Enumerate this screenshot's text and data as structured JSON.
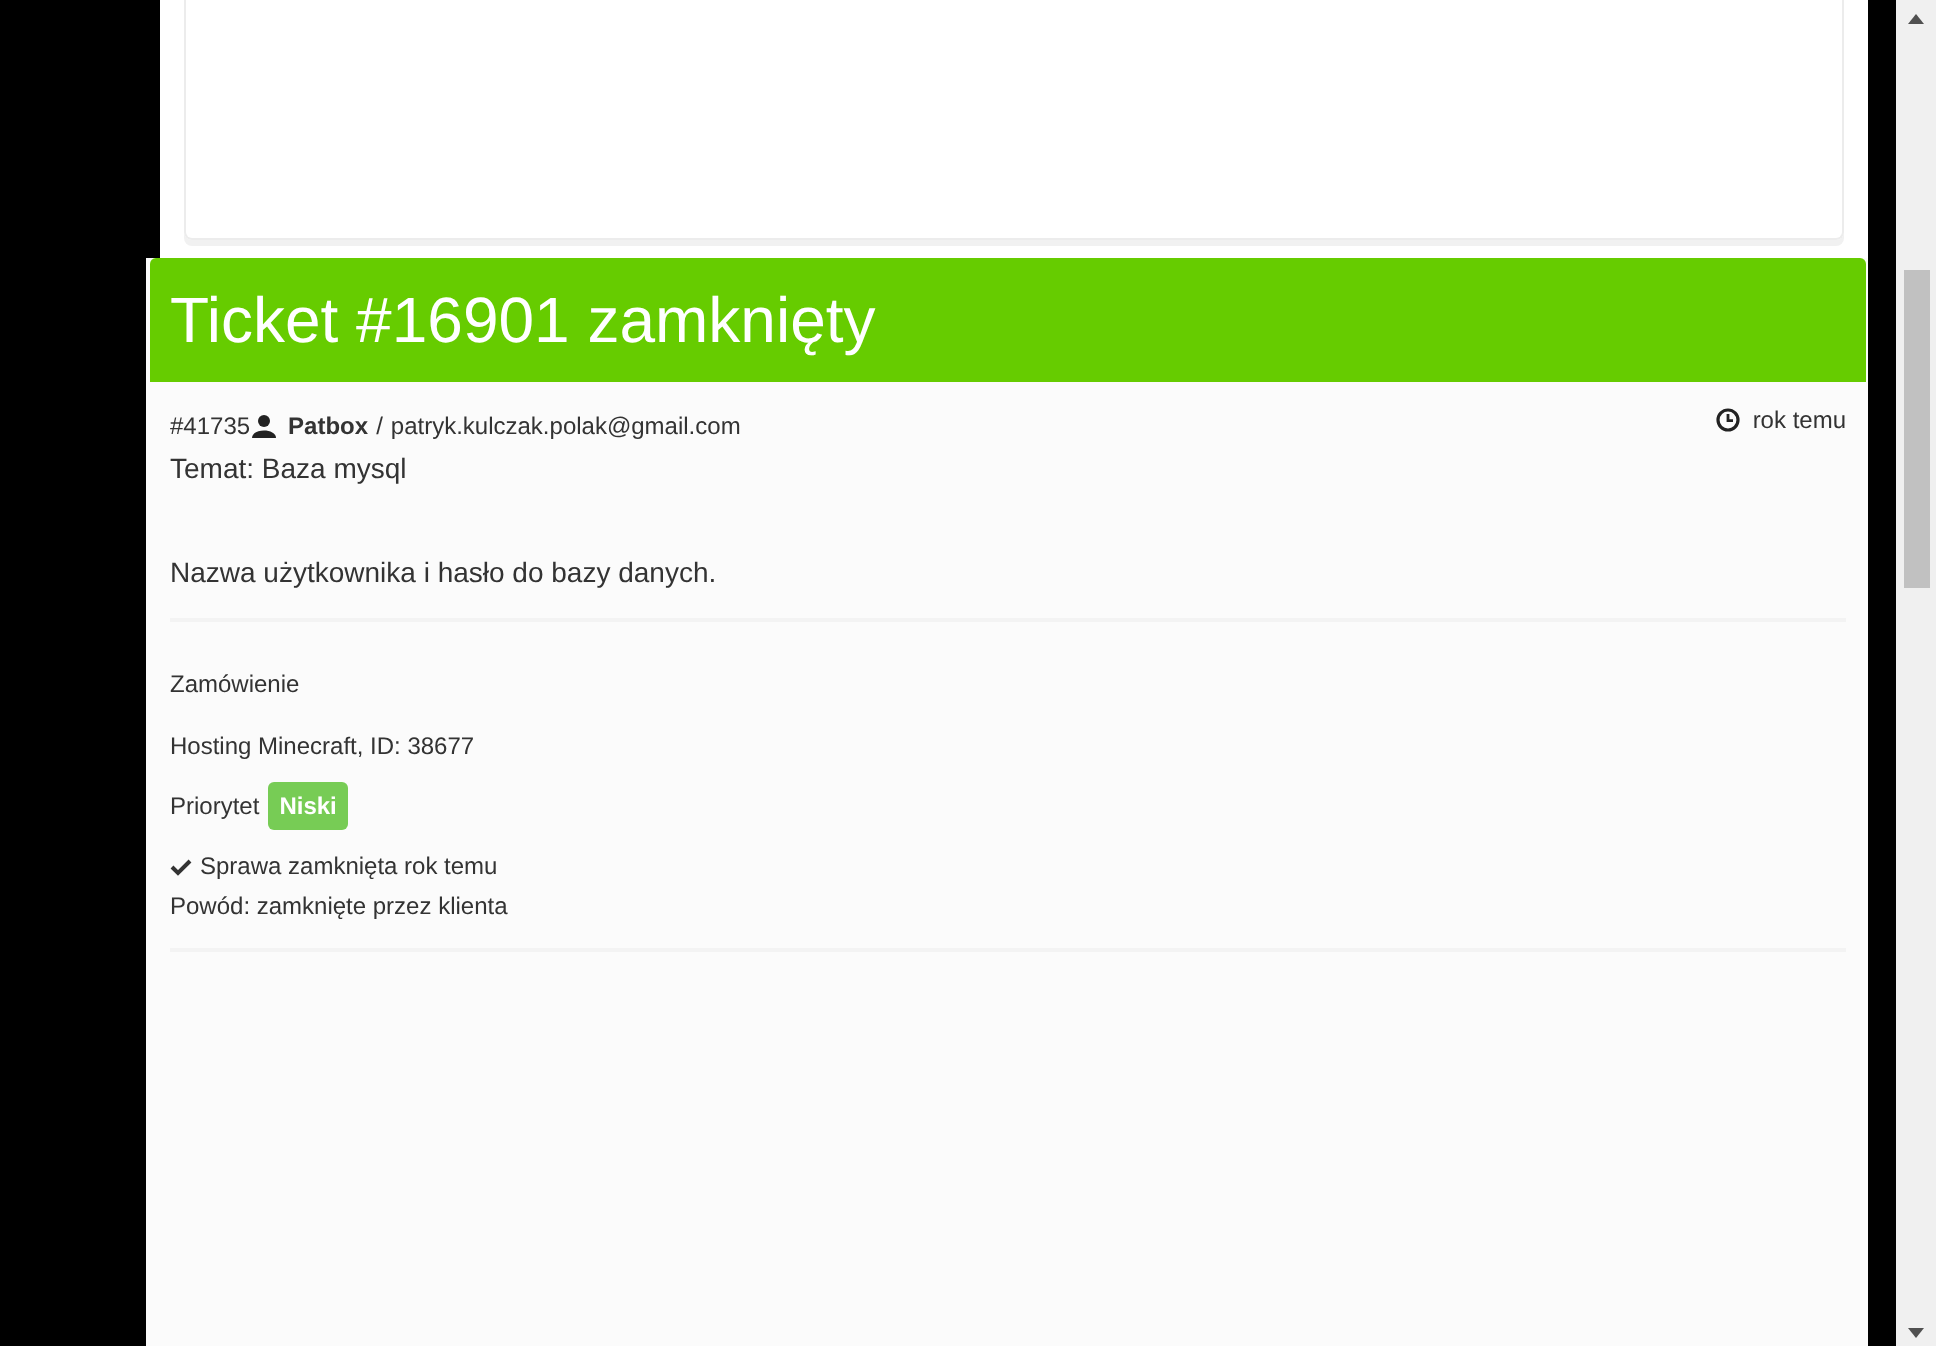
{
  "ticket": {
    "title": "Ticket #16901 zamknięty",
    "message": {
      "number": "#41735",
      "author": "Patbox",
      "separator": "/",
      "email": "patryk.kulczak.polak@gmail.com",
      "time": "rok temu",
      "subject": "Temat: Baza mysql",
      "body": "Nazwa użytkownika i hasło do bazy danych."
    },
    "details": {
      "order_label": "Zamówienie",
      "order": "Hosting Minecraft, ID: 38677",
      "priority_label": "Priorytet",
      "priority": "Niski",
      "closed": "Sprawa zamknięta rok temu",
      "reason": "Powód: zamknięte przez klienta"
    }
  }
}
